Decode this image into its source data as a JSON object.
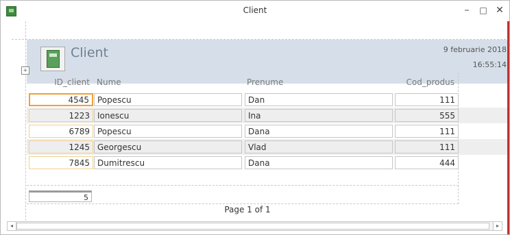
{
  "window": {
    "title": "Client",
    "controls": {
      "minimize": "–",
      "maximize": "□",
      "close": "✕"
    }
  },
  "report": {
    "title": "Client",
    "date": "9 februarie 2018",
    "time": "16:55:14",
    "columns": [
      "ID_client",
      "Nume",
      "Prenume",
      "Cod_produs"
    ],
    "rows": [
      {
        "id": "4545",
        "nume": "Popescu",
        "prenume": "Dan",
        "cod": "111"
      },
      {
        "id": "1223",
        "nume": "Ionescu",
        "prenume": "Ina",
        "cod": "555"
      },
      {
        "id": "6789",
        "nume": "Popescu",
        "prenume": "Dana",
        "cod": "111"
      },
      {
        "id": "1245",
        "nume": "Georgescu",
        "prenume": "Vlad",
        "cod": "111"
      },
      {
        "id": "7845",
        "nume": "Dumitrescu",
        "prenume": "Dana",
        "cod": "444"
      }
    ],
    "count": "5",
    "page": "Page 1 of 1"
  },
  "scrollbar": {
    "left_arrow": "◂",
    "right_arrow": "▸"
  },
  "colors": {
    "header_bg": "#d6dfe9",
    "focus_border": "#f0a030",
    "alt_row": "#eeeeee"
  },
  "icons": {
    "app": "access-report-icon",
    "header": "report-book-icon",
    "anchor": "move-handle-icon"
  }
}
